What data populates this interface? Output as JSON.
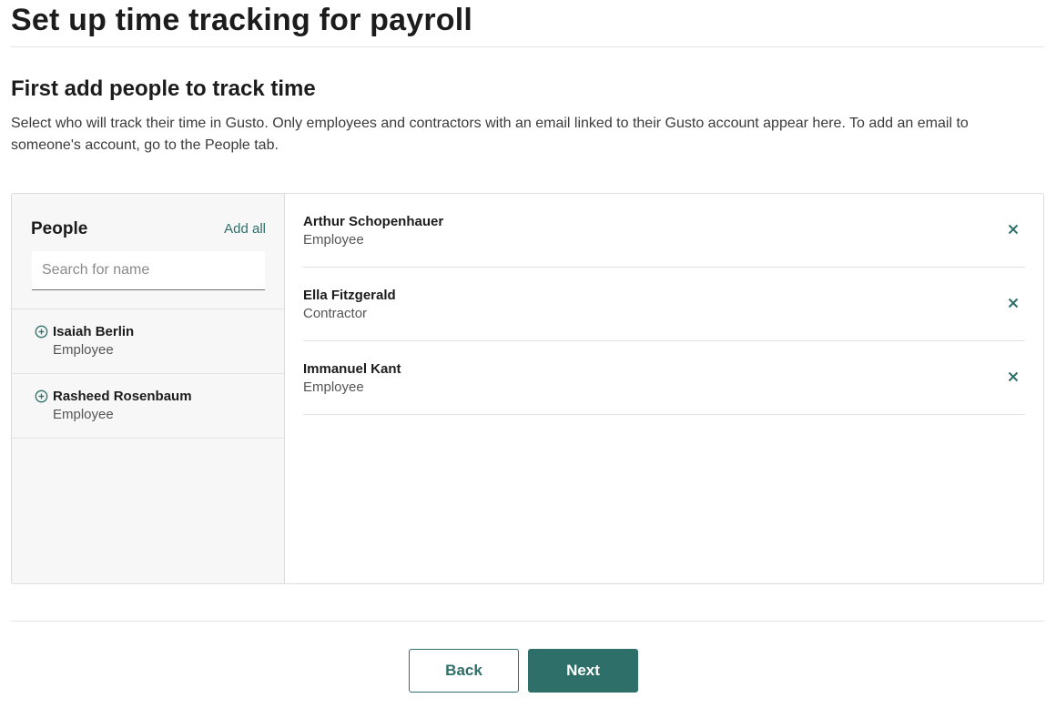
{
  "header": {
    "title": "Set up time tracking for payroll"
  },
  "section": {
    "title": "First add people to track time",
    "description": "Select who will track their time in Gusto. Only employees and contractors with an email linked to their Gusto account appear here. To add an email to someone's account, go to the People tab."
  },
  "available": {
    "label": "People",
    "add_all_label": "Add all",
    "search_placeholder": "Search for name",
    "search_value": "",
    "items": [
      {
        "name": "Isaiah Berlin",
        "role": "Employee"
      },
      {
        "name": "Rasheed Rosenbaum",
        "role": "Employee"
      }
    ]
  },
  "selected": {
    "items": [
      {
        "name": "Arthur Schopenhauer",
        "role": "Employee"
      },
      {
        "name": "Ella Fitzgerald",
        "role": "Contractor"
      },
      {
        "name": "Immanuel Kant",
        "role": "Employee"
      }
    ]
  },
  "footer": {
    "back_label": "Back",
    "next_label": "Next"
  },
  "colors": {
    "accent": "#2f6f69",
    "panel_bg": "#f7f7f7",
    "border": "#dcdcdc"
  },
  "icons": {
    "add_person": "plus-circle-icon",
    "remove_person": "close-icon"
  }
}
